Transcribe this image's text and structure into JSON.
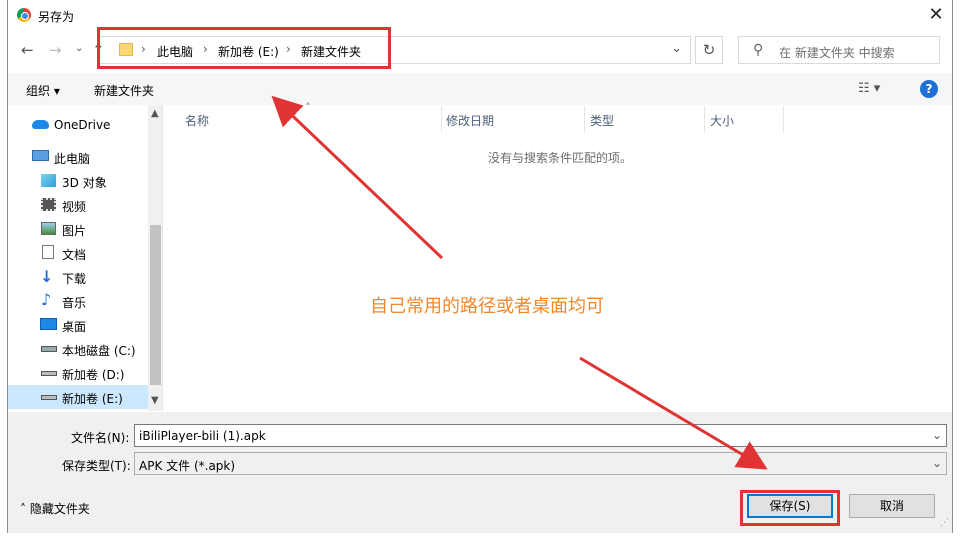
{
  "window": {
    "title": "另存为"
  },
  "address": {
    "crumbs": [
      "此电脑",
      "新加卷 (E:)",
      "新建文件夹"
    ]
  },
  "search": {
    "placeholder": "在 新建文件夹 中搜索"
  },
  "toolbar": {
    "organize": "组织 ▾",
    "new_folder": "新建文件夹",
    "view": "☷ ▾",
    "help": "?"
  },
  "sidebar": {
    "items": [
      {
        "label": "OneDrive",
        "icon": "cloud-icon"
      },
      {
        "label": "此电脑",
        "icon": "computer-icon"
      },
      {
        "label": "3D 对象",
        "icon": "cube-icon"
      },
      {
        "label": "视频",
        "icon": "video-icon"
      },
      {
        "label": "图片",
        "icon": "picture-icon"
      },
      {
        "label": "文档",
        "icon": "document-icon"
      },
      {
        "label": "下载",
        "icon": "download-icon"
      },
      {
        "label": "音乐",
        "icon": "music-icon"
      },
      {
        "label": "桌面",
        "icon": "desktop-icon"
      },
      {
        "label": "本地磁盘 (C:)",
        "icon": "drive-icon"
      },
      {
        "label": "新加卷 (D:)",
        "icon": "drive-icon"
      },
      {
        "label": "新加卷 (E:)",
        "icon": "drive-icon"
      }
    ]
  },
  "columns": [
    "名称",
    "修改日期",
    "类型",
    "大小"
  ],
  "empty_message": "没有与搜索条件匹配的项。",
  "filename": {
    "label": "文件名(N):",
    "value": "iBiliPlayer-bili (1).apk"
  },
  "filetype": {
    "label": "保存类型(T):",
    "value": "APK 文件 (*.apk)"
  },
  "footer": {
    "hide_folders": "隐藏文件夹",
    "save": "保存(S)",
    "cancel": "取消"
  },
  "annotation": {
    "text": "自己常用的路径或者桌面均可",
    "color": "#f0872c",
    "box_color": "#e03434"
  }
}
